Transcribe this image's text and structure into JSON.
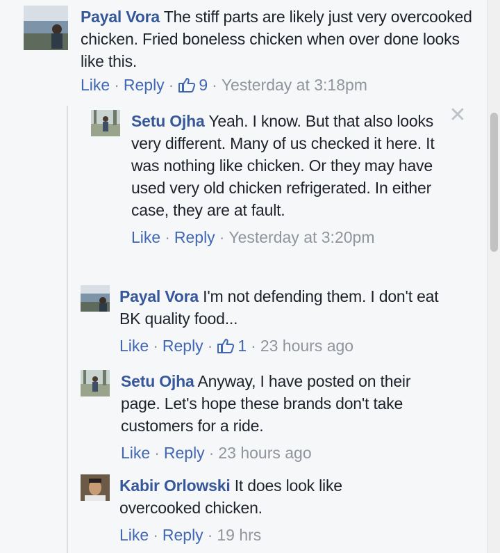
{
  "comments": [
    {
      "author": "Payal Vora",
      "text": "The stiff parts are likely just very overcooked chicken. Fried boneless chicken when over done looks like this.",
      "like_label": "Like",
      "reply_label": "Reply",
      "like_count": "9",
      "timestamp": "Yesterday at 3:18pm"
    },
    {
      "author": "Setu Ojha",
      "text": "Yeah. I know. But that also looks very different. Many of us checked it here. It was nothing like chicken. Or they may have used very old chicken refrigerated. In either case, they are at fault.",
      "like_label": "Like",
      "reply_label": "Reply",
      "timestamp": "Yesterday at 3:20pm"
    },
    {
      "author": "Payal Vora",
      "text": "I'm not defending them. I don't eat BK quality food...",
      "like_label": "Like",
      "reply_label": "Reply",
      "like_count": "1",
      "timestamp": "23 hours ago"
    },
    {
      "author": "Setu Ojha",
      "text": "Anyway, I have posted on their page. Let's hope these brands don't take customers for a ride.",
      "like_label": "Like",
      "reply_label": "Reply",
      "timestamp": "23 hours ago"
    },
    {
      "author": "Kabir Orlowski",
      "text": "It does look like overcooked chicken.",
      "like_label": "Like",
      "reply_label": "Reply",
      "timestamp": "19 hrs"
    }
  ],
  "separator": "·",
  "close_glyph": "✕",
  "colors": {
    "author": "#365899",
    "link": "#4267b2",
    "muted": "#90949c",
    "background": "#f6f7f9"
  }
}
